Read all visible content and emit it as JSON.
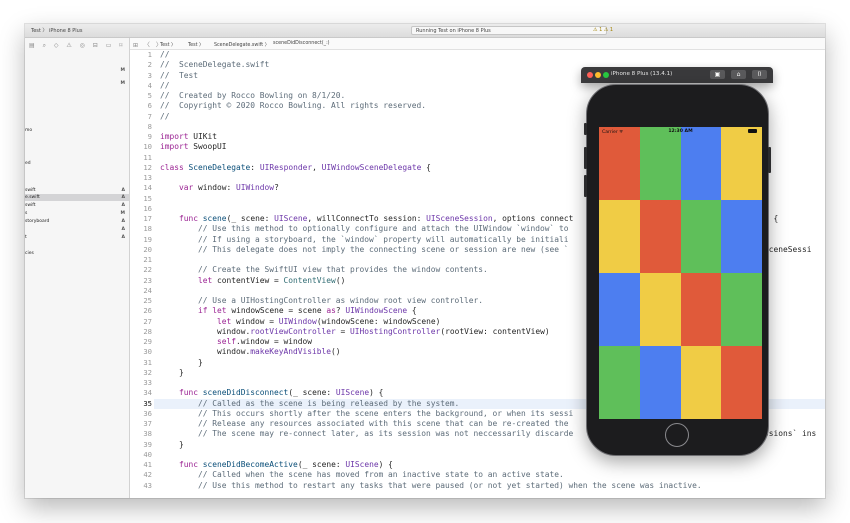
{
  "titlebar": {
    "scheme": "Test 〉 iPhone 8 Plus",
    "status_text": "Running Test on iPhone 8 Plus",
    "warning_icons": "⚠ 1 ⚠ 1"
  },
  "navigator": {
    "icons": "▤ ⌕ ◇ ⚠ ◎ ⊟ ▭ ⌑",
    "rows": [
      {
        "label": "",
        "badge": "M"
      },
      {
        "label": "",
        "badge": "M"
      },
      {
        "label": "mo",
        "badge": ""
      },
      {
        "label": "ed",
        "badge": ""
      },
      {
        "label": "swift",
        "badge": "A"
      },
      {
        "label": "e.swift",
        "badge": "A"
      },
      {
        "label": "swift",
        "badge": "A"
      },
      {
        "label": "s",
        "badge": "M"
      },
      {
        "label": "storyboard",
        "badge": "A"
      },
      {
        "label": "",
        "badge": "A"
      },
      {
        "label": "t",
        "badge": "A"
      },
      {
        "label": "cies",
        "badge": ""
      }
    ]
  },
  "jumpbar": {
    "icons": "⊞ 〈 〉",
    "crumbs": [
      "Test 〉",
      "Test 〉",
      "SceneDelegate.swift 〉",
      "sceneDidDisconnect(_:)"
    ]
  },
  "editor": {
    "current_line": 35,
    "lines": [
      {
        "n": "1",
        "html": "<span class='c'>//</span>"
      },
      {
        "n": "2",
        "html": "<span class='c'>//  SceneDelegate.swift</span>"
      },
      {
        "n": "3",
        "html": "<span class='c'>//  Test</span>"
      },
      {
        "n": "4",
        "html": "<span class='c'>//</span>"
      },
      {
        "n": "5",
        "html": "<span class='c'>//  Created by Rocco Bowling on 8/1/20.</span>"
      },
      {
        "n": "6",
        "html": "<span class='c'>//  Copyright © 2020 Rocco Bowling. All rights reserved.</span>"
      },
      {
        "n": "7",
        "html": "<span class='c'>//</span>"
      },
      {
        "n": "8",
        "html": ""
      },
      {
        "n": "9",
        "html": "<span class='k'>import</span> UIKit"
      },
      {
        "n": "10",
        "html": "<span class='k'>import</span> SwoopUI"
      },
      {
        "n": "11",
        "html": ""
      },
      {
        "n": "12",
        "html": "<span class='k'>class</span> <span class='t'>SceneDelegate</span>: <span class='m'>UIResponder</span>, <span class='m'>UIWindowSceneDelegate</span> {"
      },
      {
        "n": "13",
        "html": ""
      },
      {
        "n": "14",
        "html": "    <span class='k'>var</span> window: <span class='m'>UIWindow</span>?"
      },
      {
        "n": "15",
        "html": ""
      },
      {
        "n": "16",
        "html": ""
      },
      {
        "n": "17",
        "html": "    <span class='k'>func</span> <span class='t'>scene</span>(_ scene: <span class='m'>UIScene</span>, willConnectTo session: <span class='m'>UISceneSession</span>, options connect"
      },
      {
        "n": "18",
        "html": "        <span class='c'>// Use this method to optionally configure and attach the UIWindow `window` to</span>"
      },
      {
        "n": "19",
        "html": "        <span class='c'>// If using a storyboard, the `window` property will automatically be initiali</span>"
      },
      {
        "n": "20",
        "html": "        <span class='c'>// This delegate does not imply the connecting scene or session are new (see `</span>"
      },
      {
        "n": "21",
        "html": ""
      },
      {
        "n": "22",
        "html": "        <span class='c'>// Create the SwiftUI view that provides the window contents.</span>"
      },
      {
        "n": "23",
        "html": "        <span class='k'>let</span> contentView = <span class='f'>ContentView</span>()"
      },
      {
        "n": "24",
        "html": ""
      },
      {
        "n": "25",
        "html": "        <span class='c'>// Use a UIHostingController as window root view controller.</span>"
      },
      {
        "n": "26",
        "html": "        <span class='k'>if</span> <span class='k'>let</span> windowScene = scene <span class='k'>as</span>? <span class='m'>UIWindowScene</span> {"
      },
      {
        "n": "27",
        "html": "            <span class='k'>let</span> window = <span class='m'>UIWindow</span>(windowScene: windowScene)"
      },
      {
        "n": "28",
        "html": "            window.<span class='m'>rootViewController</span> = <span class='m'>UIHostingController</span>(rootView: contentView)"
      },
      {
        "n": "29",
        "html": "            <span class='k'>self</span>.window = window"
      },
      {
        "n": "30",
        "html": "            window.<span class='m'>makeKeyAndVisible</span>()"
      },
      {
        "n": "31",
        "html": "        }"
      },
      {
        "n": "32",
        "html": "    }"
      },
      {
        "n": "33",
        "html": ""
      },
      {
        "n": "34",
        "html": "    <span class='k'>func</span> <span class='t'>sceneDidDisconnect</span>(_ scene: <span class='m'>UIScene</span>) {"
      },
      {
        "n": "35",
        "html": "        <span class='c'>// Called as the scene is being released by the system.</span>"
      },
      {
        "n": "36",
        "html": "        <span class='c'>// This occurs shortly after the scene enters the background, or when its sessi</span>"
      },
      {
        "n": "37",
        "html": "        <span class='c'>// Release any resources associated with this scene that can be re-created the</span>"
      },
      {
        "n": "38",
        "html": "        <span class='c'>// The scene may re-connect later, as its session was not neccessarily discarde</span>"
      },
      {
        "n": "39",
        "html": "    }"
      },
      {
        "n": "40",
        "html": ""
      },
      {
        "n": "41",
        "html": "    <span class='k'>func</span> <span class='t'>sceneDidBecomeActive</span>(_ scene: <span class='m'>UIScene</span>) {"
      },
      {
        "n": "42",
        "html": "        <span class='c'>// Called when the scene has moved from an inactive state to an active state.</span>"
      },
      {
        "n": "43",
        "html": "        <span class='c'>// Use this method to restart any tasks that were paused (or not yet started) when the scene was inactive.</span>"
      }
    ],
    "overflow_snippets": [
      {
        "line": 17,
        "text": ") {"
      },
      {
        "line": 20,
        "text": "SceneSessi"
      },
      {
        "line": 38,
        "text": "ssions` ins"
      }
    ]
  },
  "simulator": {
    "title": "iPhone 8 Plus (13.4.1)",
    "buttons": [
      "▣",
      "⌂",
      "⌷"
    ],
    "status": {
      "carrier": "Carrier ᯤ",
      "time": "12:30 AM"
    },
    "colors": {
      "red": "#e05a3a",
      "green": "#5fbf5a",
      "blue": "#4d7ef0",
      "yellow": "#f0cc45"
    },
    "grid": [
      [
        "red",
        "green",
        "blue",
        "yellow"
      ],
      [
        "yellow",
        "red",
        "green",
        "blue"
      ],
      [
        "blue",
        "yellow",
        "red",
        "green"
      ],
      [
        "green",
        "blue",
        "yellow",
        "red"
      ]
    ]
  }
}
